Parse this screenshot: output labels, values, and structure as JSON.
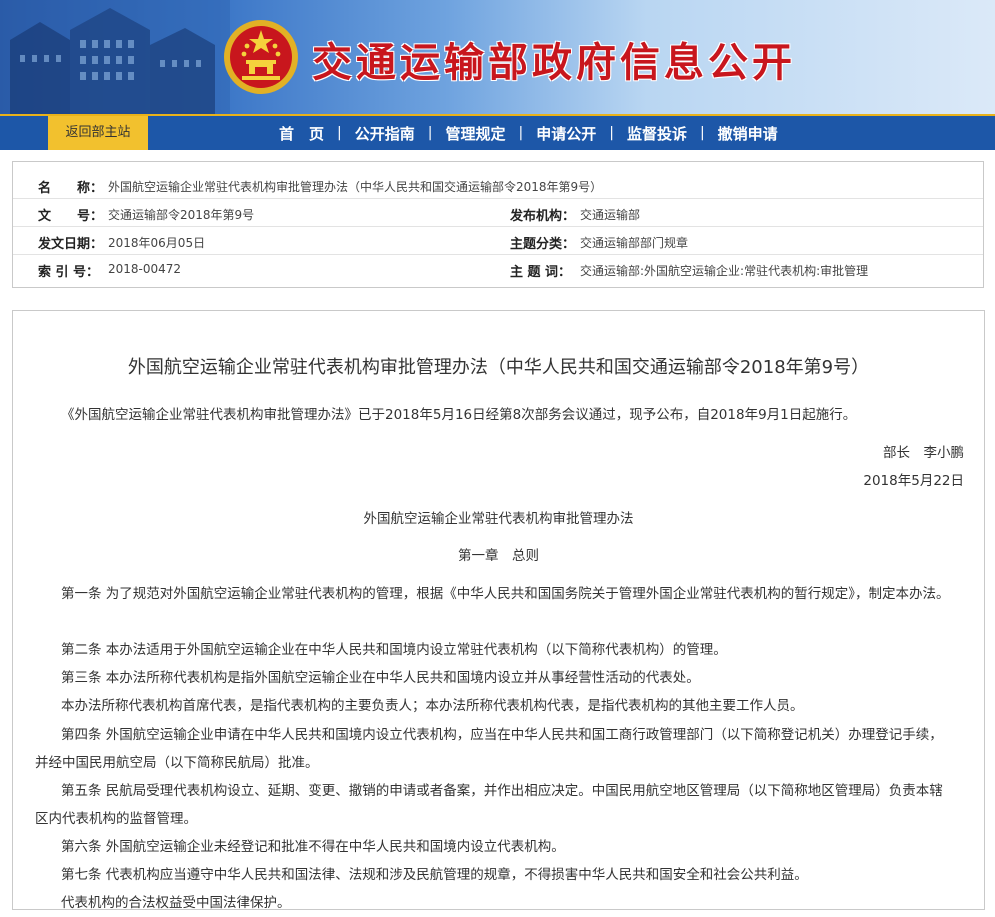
{
  "header": {
    "site_title": "交通运输部政府信息公开"
  },
  "nav": {
    "back_label": "返回部主站",
    "items": [
      "首　页",
      "公开指南",
      "管理规定",
      "申请公开",
      "监督投诉",
      "撤销申请"
    ],
    "separator": "|"
  },
  "meta": {
    "name_label": "名　　称：",
    "name_value": "外国航空运输企业常驻代表机构审批管理办法（中华人民共和国交通运输部令2018年第9号）",
    "docno_label": "文　　号：",
    "docno_value": "交通运输部令2018年第9号",
    "issuer_label": "发布机构：",
    "issuer_value": "交通运输部",
    "date_label": "发文日期：",
    "date_value": "2018年06月05日",
    "category_label": "主题分类：",
    "category_value": "交通运输部部门规章",
    "index_label": "索 引 号：",
    "index_value": "2018-00472",
    "keywords_label": "主 题 词：",
    "keywords_value": "交通运输部:外国航空运输企业:常驻代表机构:审批管理"
  },
  "doc": {
    "title": "外国航空运输企业常驻代表机构审批管理办法（中华人民共和国交通运输部令2018年第9号）",
    "intro": "《外国航空运输企业常驻代表机构审批管理办法》已于2018年5月16日经第8次部务会议通过，现予公布，自2018年9月1日起施行。",
    "signer": "部长　李小鹏",
    "sign_date": "2018年5月22日",
    "subtitle": "外国航空运输企业常驻代表机构审批管理办法",
    "chapter": "第一章　总则",
    "articles": [
      "第一条 为了规范对外国航空运输企业常驻代表机构的管理，根据《中华人民共和国国务院关于管理外国企业常驻代表机构的暂行规定》，制定本办法。",
      "第二条 本办法适用于外国航空运输企业在中华人民共和国境内设立常驻代表机构（以下简称代表机构）的管理。",
      "第三条 本办法所称代表机构是指外国航空运输企业在中华人民共和国境内设立并从事经营性活动的代表处。",
      "本办法所称代表机构首席代表，是指代表机构的主要负责人；本办法所称代表机构代表，是指代表机构的其他主要工作人员。",
      "第四条 外国航空运输企业申请在中华人民共和国境内设立代表机构，应当在中华人民共和国工商行政管理部门（以下简称登记机关）办理登记手续，并经中国民用航空局（以下简称民航局）批准。",
      "第五条 民航局受理代表机构设立、延期、变更、撤销的申请或者备案，并作出相应决定。中国民用航空地区管理局（以下简称地区管理局）负责本辖区内代表机构的监督管理。",
      "第六条 外国航空运输企业未经登记和批准不得在中华人民共和国境内设立代表机构。",
      "第七条 代表机构应当遵守中华人民共和国法律、法规和涉及民航管理的规章，不得损害中华人民共和国安全和社会公共利益。",
      "代表机构的合法权益受中国法律保护。"
    ]
  },
  "colors": {
    "title_red": "#c8161d",
    "nav_blue": "#1d57a8",
    "nav_gold": "#f2c12e"
  }
}
